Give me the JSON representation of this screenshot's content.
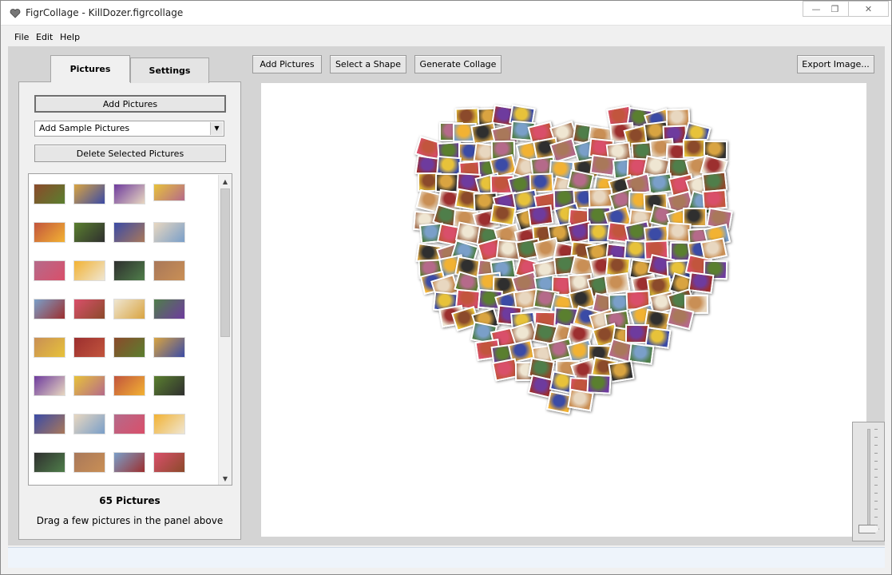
{
  "window": {
    "title": "FigrCollage - KillDozer.figrcollage",
    "minimize_glyph": "—",
    "maximize_glyph": "❐",
    "close_glyph": "✕"
  },
  "menu": {
    "file": "File",
    "edit": "Edit",
    "help": "Help"
  },
  "tabs": {
    "pictures": "Pictures",
    "settings": "Settings"
  },
  "left_panel": {
    "add_pictures": "Add Pictures",
    "sample_select": "Add Sample Pictures",
    "delete_selected": "Delete Selected Pictures",
    "picture_count": "65 Pictures",
    "drag_hint": "Drag a few pictures in the panel above"
  },
  "toolbar": {
    "add_pictures": "Add Pictures",
    "select_shape": "Select a Shape",
    "generate_collage": "Generate Collage",
    "export_image": "Export Image..."
  },
  "icons": {
    "app": "heart-icon",
    "dropdown": "chevron-down-icon",
    "scroll_up": "scroll-up-icon",
    "scroll_down": "scroll-down-icon"
  },
  "colors": {
    "photo_palette": [
      "#8b4a2b",
      "#d9a441",
      "#6e3b9e",
      "#e7c23a",
      "#c2553d",
      "#5a7f2f",
      "#3b4ba6",
      "#e8d7c0",
      "#b56a8a",
      "#f2b233",
      "#2f2f2f",
      "#a9785a",
      "#7a9fc9",
      "#d94f6a",
      "#efe6d2",
      "#4f7e4a",
      "#c98f55",
      "#9c2f2f"
    ]
  },
  "collage": {
    "shape": "heart",
    "photo_count": 65
  }
}
